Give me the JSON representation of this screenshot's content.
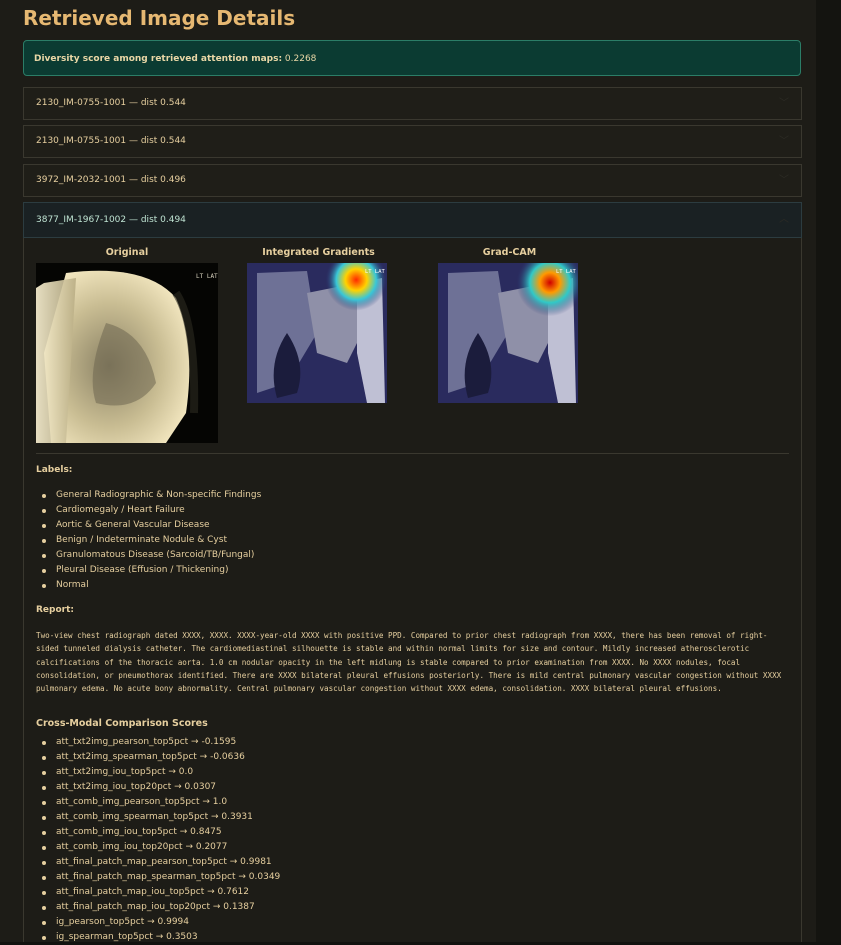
{
  "title": "Retrieved Image Details",
  "diversity": {
    "label": "Diversity score among retrieved attention maps:",
    "value": "0.2268"
  },
  "results": [
    {
      "label": "2130_IM-0755-1001 — dist 0.544"
    },
    {
      "label": "2130_IM-0755-1001 — dist 0.544"
    },
    {
      "label": "3972_IM-2032-1001 — dist 0.496"
    },
    {
      "label": "3877_IM-1967-1002 — dist 0.494"
    }
  ],
  "images": {
    "original": "Original",
    "ig": "Integrated Gradients",
    "gradcam": "Grad-CAM"
  },
  "labels_heading": "Labels:",
  "labels": [
    "General Radiographic & Non-specific Findings",
    "Cardiomegaly / Heart Failure",
    "Aortic & General Vascular Disease",
    "Benign / Indeterminate Nodule & Cyst",
    "Granulomatous Disease (Sarcoid/TB/Fungal)",
    "Pleural Disease (Effusion / Thickening)",
    "Normal"
  ],
  "report_heading": "Report:",
  "report": "Two-view chest radiograph dated XXXX, XXXX. XXXX-year-old XXXX with positive PPD. Compared to prior chest radiograph from XXXX, there has been removal of right-sided tunneled dialysis catheter. The cardiomediastinal silhouette is stable and within normal limits for size and contour. Mildly increased atherosclerotic calcifications of the thoracic aorta. 1.0 cm nodular opacity in the left midlung is stable compared to prior examination from XXXX. No XXXX nodules, focal consolidation, or pneumothorax identified. There are XXXX bilateral pleural effusions posteriorly. There is mild central pulmonary vascular congestion without XXXX pulmonary edema. No acute bony abnormality. Central pulmonary vascular congestion without XXXX edema, consolidation. XXXX bilateral pleural effusions.",
  "scores_heading": "Cross-Modal Comparison Scores",
  "scores": [
    "att_txt2img_pearson_top5pct → -0.1595",
    "att_txt2img_spearman_top5pct → -0.0636",
    "att_txt2img_iou_top5pct → 0.0",
    "att_txt2img_iou_top20pct → 0.0307",
    "att_comb_img_pearson_top5pct → 1.0",
    "att_comb_img_spearman_top5pct → 0.3931",
    "att_comb_img_iou_top5pct → 0.8475",
    "att_comb_img_iou_top20pct → 0.2077",
    "att_final_patch_map_pearson_top5pct → 0.9981",
    "att_final_patch_map_spearman_top5pct → 0.0349",
    "att_final_patch_map_iou_top5pct → 0.7612",
    "att_final_patch_map_iou_top20pct → 0.1387",
    "ig_pearson_top5pct → 0.9994",
    "ig_spearman_top5pct → 0.3503"
  ],
  "image_overlay_text": "LT LAT"
}
